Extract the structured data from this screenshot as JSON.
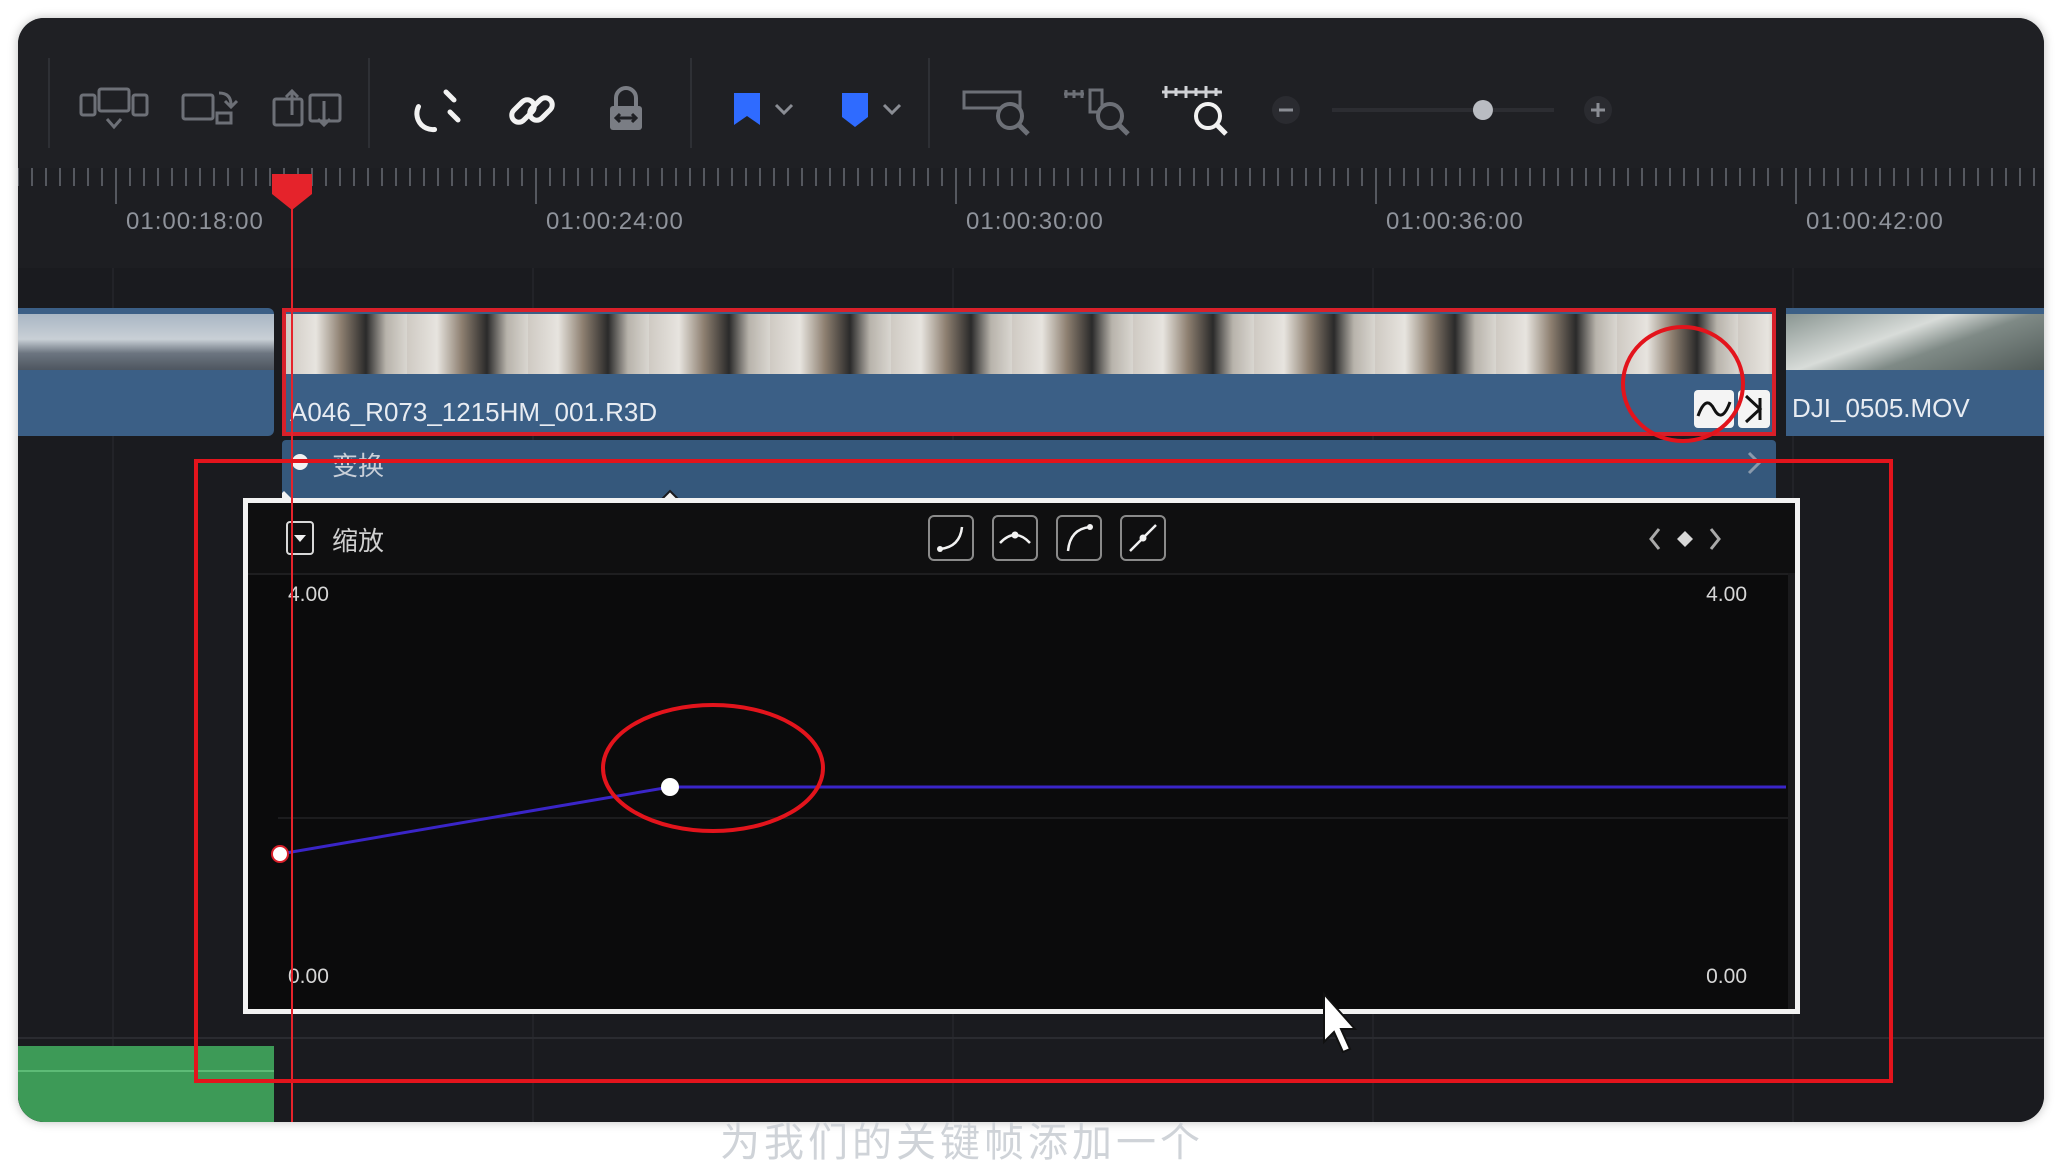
{
  "toolbar": {
    "icons": [
      "monitor-down-icon",
      "replace-clip-icon",
      "swap-clip-icon",
      "snap-magnet-icon",
      "link-icon",
      "lock-icon",
      "flag-icon",
      "marker-icon",
      "zoom-full-icon",
      "zoom-detail-icon",
      "zoom-custom-icon",
      "zoom-out-icon",
      "zoom-in-icon"
    ],
    "flag_color": "#2f6bff",
    "zoom_level": 0.68
  },
  "ruler": {
    "timecodes": [
      "01:00:18:00",
      "01:00:24:00",
      "01:00:30:00",
      "01:00:36:00",
      "01:00:42:00"
    ]
  },
  "clips": {
    "main_clip_name": "A046_R073_1215HM_001.R3D",
    "next_clip_name": "DJI_0505.MOV"
  },
  "track_header": {
    "label": "变换"
  },
  "curve_editor": {
    "property_label": "缩放",
    "top_left_value": "4.00",
    "top_right_value": "4.00",
    "bottom_left_value": "0.00",
    "bottom_right_value": "0.00",
    "line_color": "#3a25c8"
  },
  "subtitle": {
    "text": "为我们的关键帧添加一个"
  }
}
